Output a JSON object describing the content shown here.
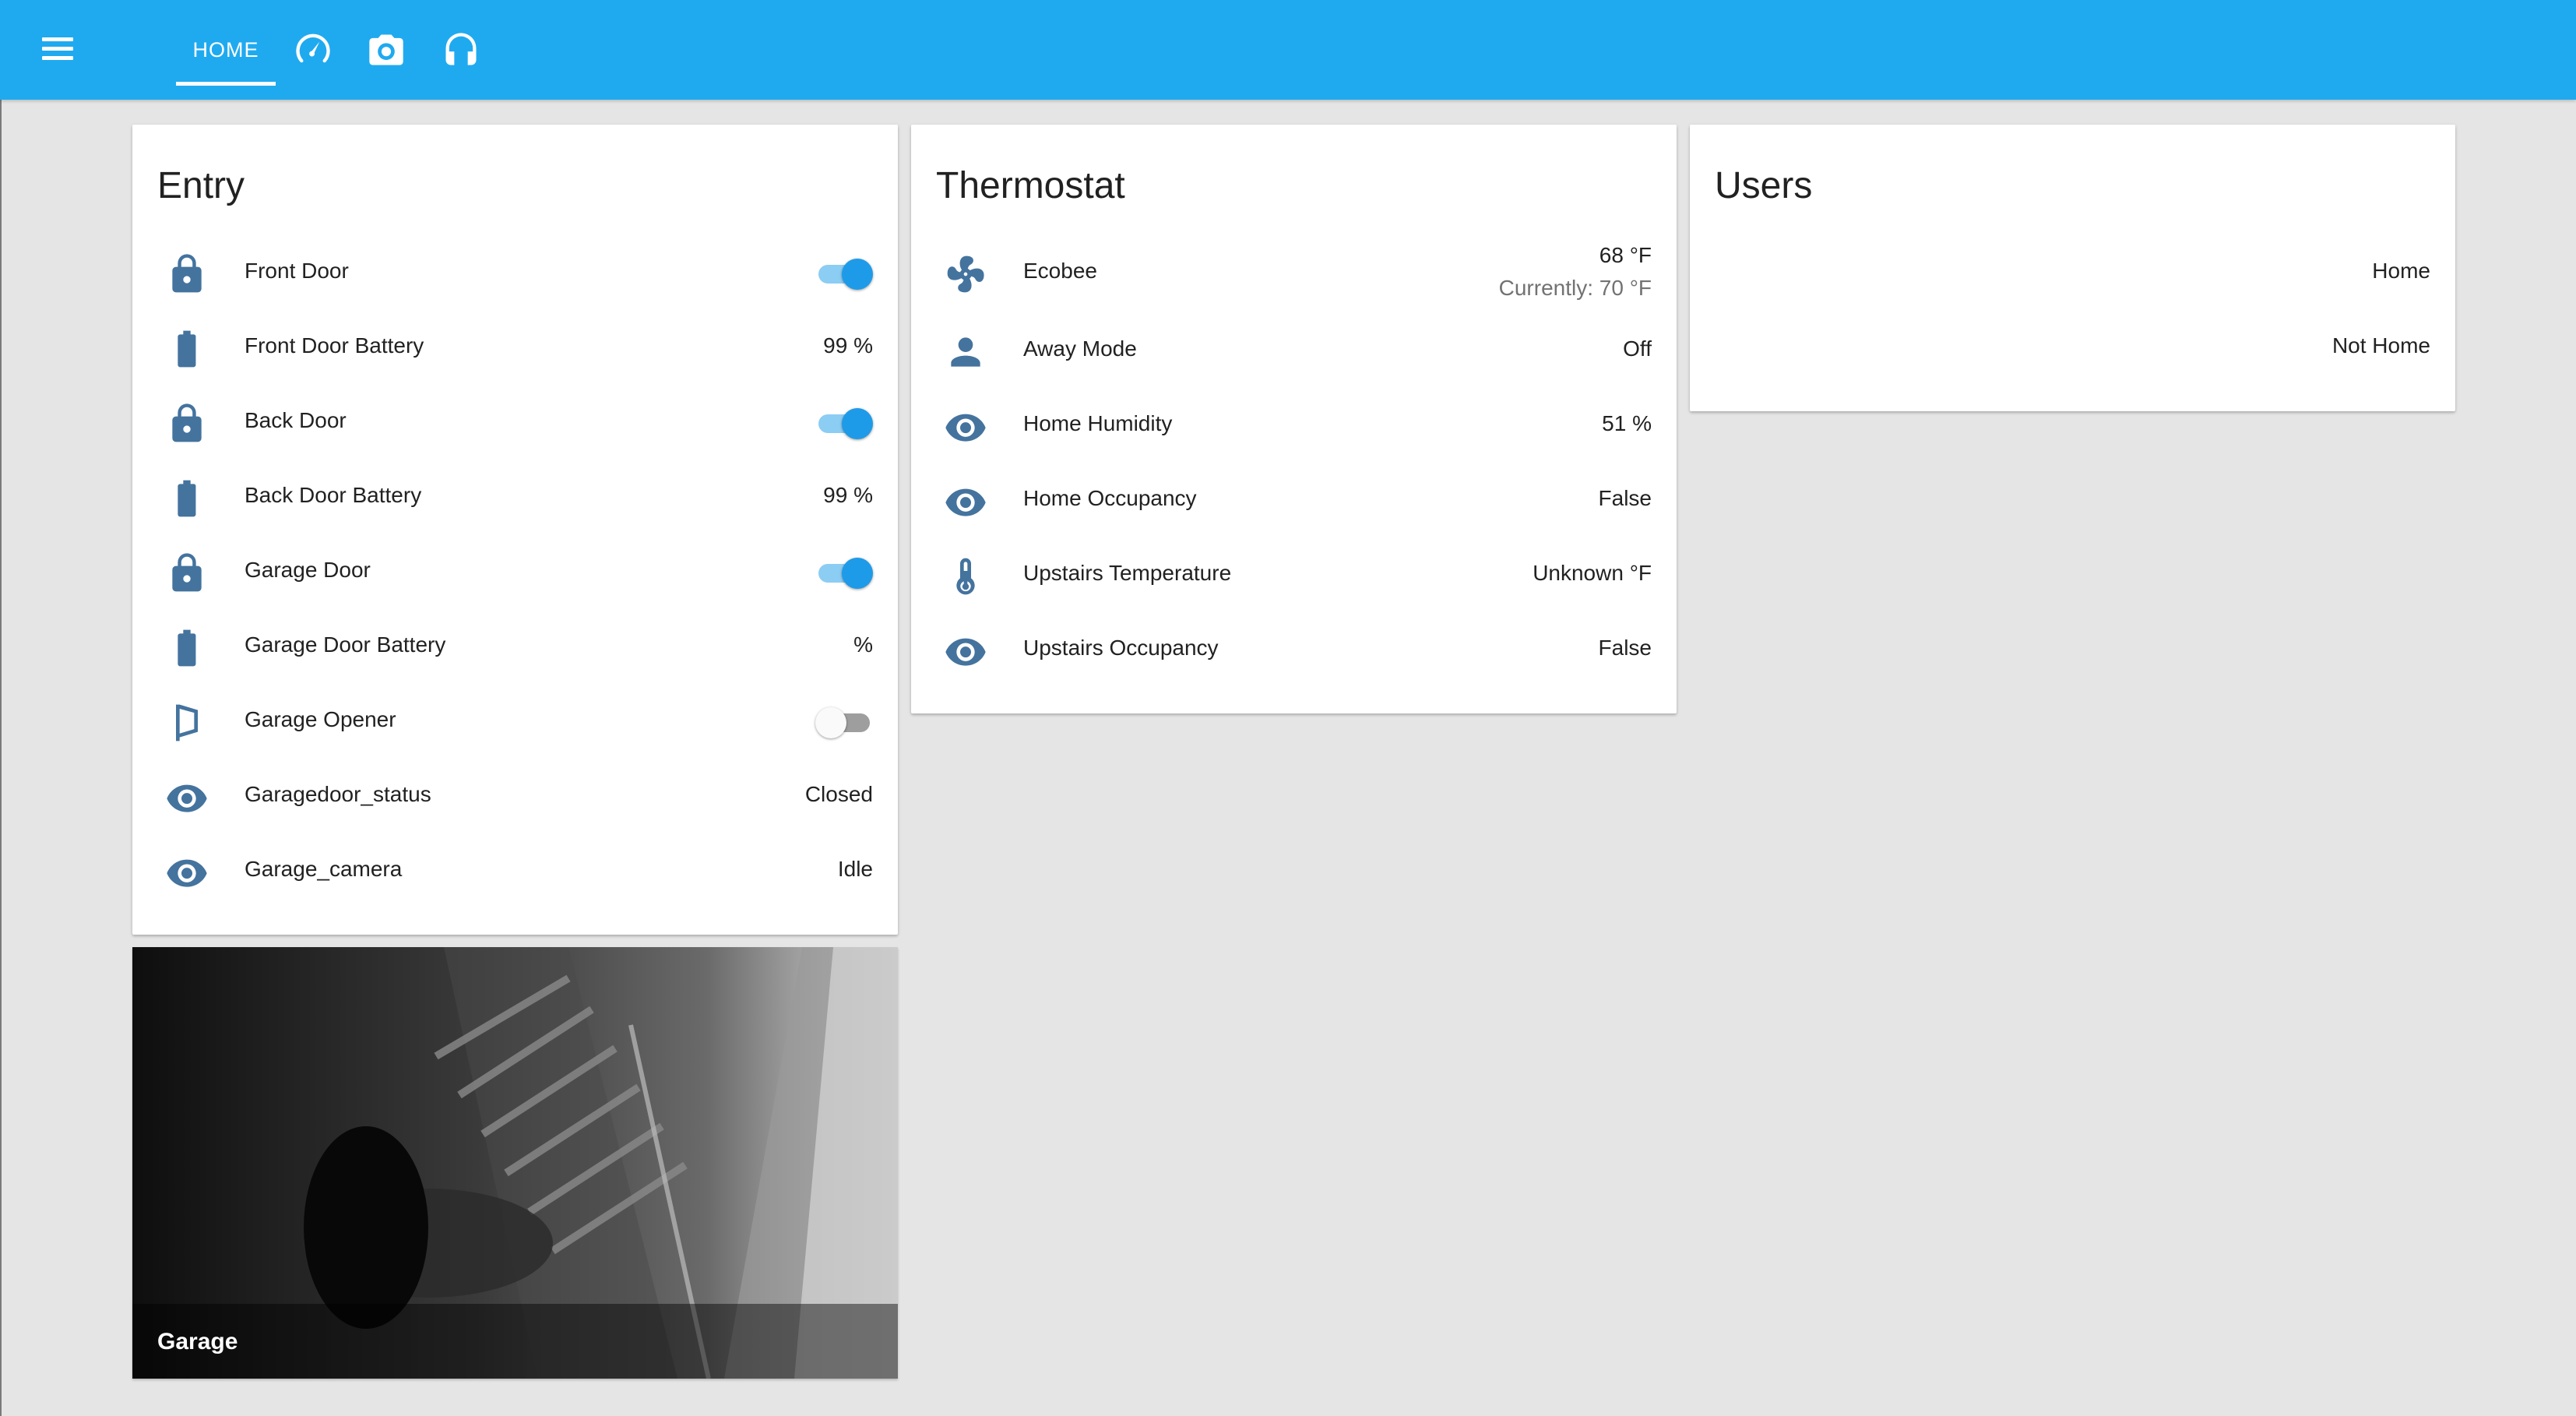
{
  "header": {
    "tabs": [
      {
        "label": "HOME",
        "active": true
      },
      {
        "icon": "speedometer-icon"
      },
      {
        "icon": "camera-icon"
      },
      {
        "icon": "headphones-icon"
      }
    ],
    "accent": "#1faaf0"
  },
  "entry": {
    "title": "Entry",
    "rows": [
      {
        "label": "Front Door",
        "icon": "lock-icon",
        "toggle": true
      },
      {
        "label": "Front Door Battery",
        "icon": "battery-icon",
        "value": "99 %"
      },
      {
        "label": "Back Door",
        "icon": "lock-icon",
        "toggle": true
      },
      {
        "label": "Back Door Battery",
        "icon": "battery-icon",
        "value": "99 %"
      },
      {
        "label": "Garage Door",
        "icon": "lock-icon",
        "toggle": true
      },
      {
        "label": "Garage Door Battery",
        "icon": "battery-icon",
        "value": "%"
      },
      {
        "label": "Garage Opener",
        "icon": "garage-door-icon",
        "toggle": false
      },
      {
        "label": "Garagedoor_status",
        "icon": "eye-icon",
        "value": "Closed"
      },
      {
        "label": "Garage_camera",
        "icon": "eye-icon",
        "value": "Idle"
      }
    ]
  },
  "thermostat": {
    "title": "Thermostat",
    "rows": [
      {
        "label": "Ecobee",
        "icon": "fan-icon",
        "value": "68 °F",
        "value2": "Currently: 70 °F"
      },
      {
        "label": "Away Mode",
        "icon": "person-icon",
        "value": "Off"
      },
      {
        "label": "Home Humidity",
        "icon": "eye-icon",
        "value": "51 %"
      },
      {
        "label": "Home Occupancy",
        "icon": "eye-icon",
        "value": "False"
      },
      {
        "label": "Upstairs Temperature",
        "icon": "thermometer-icon",
        "value": "Unknown °F"
      },
      {
        "label": "Upstairs Occupancy",
        "icon": "eye-icon",
        "value": "False"
      }
    ]
  },
  "users": {
    "title": "Users",
    "rows": [
      {
        "value": "Home"
      },
      {
        "value": "Not Home"
      }
    ]
  },
  "camera": {
    "caption": "Garage"
  }
}
